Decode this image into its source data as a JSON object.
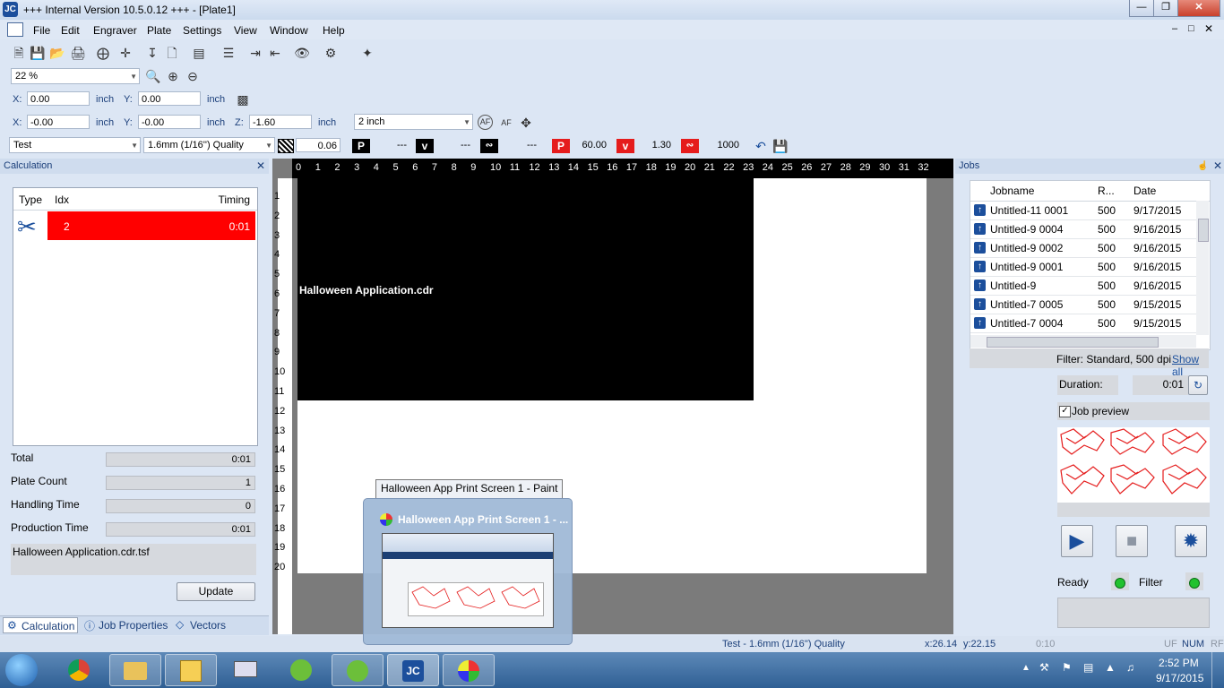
{
  "window": {
    "title": "+++ Internal Version 10.5.0.12 +++ - [Plate1]",
    "app_icon": "JC"
  },
  "menu": [
    "File",
    "Edit",
    "Engraver",
    "Plate",
    "Settings",
    "View",
    "Window",
    "Help"
  ],
  "zoom": {
    "value": "22 %"
  },
  "pos1": {
    "x_label": "X:",
    "x": "0.00",
    "x_unit": "inch",
    "y_label": "Y:",
    "y": "0.00",
    "y_unit": "inch"
  },
  "pos2": {
    "x_label": "X:",
    "x": "-0.00",
    "x_unit": "inch",
    "y_label": "Y:",
    "y": "-0.00",
    "y_unit": "inch",
    "z_label": "Z:",
    "z": "-1.60",
    "z_unit": "inch",
    "step": "2 inch"
  },
  "params": {
    "profile": "Test",
    "quality": "1.6mm (1/16'') Quality",
    "line_height": "0.06",
    "p1": "---",
    "v1": "---",
    "f1": "---",
    "p2": "60.00",
    "v2": "1.30",
    "f2": "1000",
    "p_badge": "P",
    "v_badge": "v"
  },
  "calc": {
    "title": "Calculation",
    "cols": [
      "Type",
      "Idx",
      "Timing"
    ],
    "row": {
      "idx": "2",
      "timing": "0:01"
    },
    "fields": [
      {
        "label": "Total",
        "value": "0:01"
      },
      {
        "label": "Plate Count",
        "value": "1"
      },
      {
        "label": "Handling Time",
        "value": "0"
      },
      {
        "label": "Production Time",
        "value": "0:01"
      }
    ],
    "filename": "Halloween Application.cdr.tsf",
    "update": "Update",
    "tabs": [
      "Calculation",
      "Job Properties",
      "Vectors"
    ]
  },
  "canvas": {
    "h_ruler": [
      "0",
      "1",
      "2",
      "3",
      "4",
      "5",
      "6",
      "7",
      "8",
      "9",
      "10",
      "11",
      "12",
      "13",
      "14",
      "15",
      "16",
      "17",
      "18",
      "19",
      "20",
      "21",
      "22",
      "23",
      "24",
      "25",
      "26",
      "27",
      "28",
      "29",
      "30",
      "31",
      "32"
    ],
    "v_ruler": [
      "1",
      "2",
      "3",
      "4",
      "5",
      "6",
      "7",
      "8",
      "9",
      "10",
      "11",
      "12",
      "13",
      "14",
      "15",
      "16",
      "17",
      "18",
      "19",
      "20"
    ],
    "label": "Halloween Application.cdr"
  },
  "jobs": {
    "title": "Jobs",
    "cols": [
      "Jobname",
      "R...",
      "Date"
    ],
    "rows": [
      {
        "name": "Untitled-11 0001",
        "r": "500",
        "date": "9/17/2015"
      },
      {
        "name": "Untitled-9 0004",
        "r": "500",
        "date": "9/16/2015"
      },
      {
        "name": "Untitled-9 0002",
        "r": "500",
        "date": "9/16/2015"
      },
      {
        "name": "Untitled-9 0001",
        "r": "500",
        "date": "9/16/2015"
      },
      {
        "name": "Untitled-9",
        "r": "500",
        "date": "9/16/2015"
      },
      {
        "name": "Untitled-7 0005",
        "r": "500",
        "date": "9/15/2015"
      },
      {
        "name": "Untitled-7 0004",
        "r": "500",
        "date": "9/15/2015"
      }
    ],
    "filter": "Filter: Standard, 500 dpi",
    "show_all": "Show all",
    "duration_label": "Duration:",
    "duration": "0:01",
    "job_preview": "Job preview",
    "ready": "Ready",
    "filter_label": "Filter"
  },
  "status": {
    "quality": "Test - 1.6mm (1/16'') Quality",
    "x": "x:26.14",
    "y": "y:22.15",
    "time": "0:10",
    "uf": "UF",
    "num": "NUM",
    "rf": "RF"
  },
  "taskbar": {
    "popup_title": "Halloween App Print Screen 1 - ...",
    "tooltip": "Halloween App Print Screen 1 - Paint",
    "time": "2:52 PM",
    "date": "9/17/2015"
  }
}
